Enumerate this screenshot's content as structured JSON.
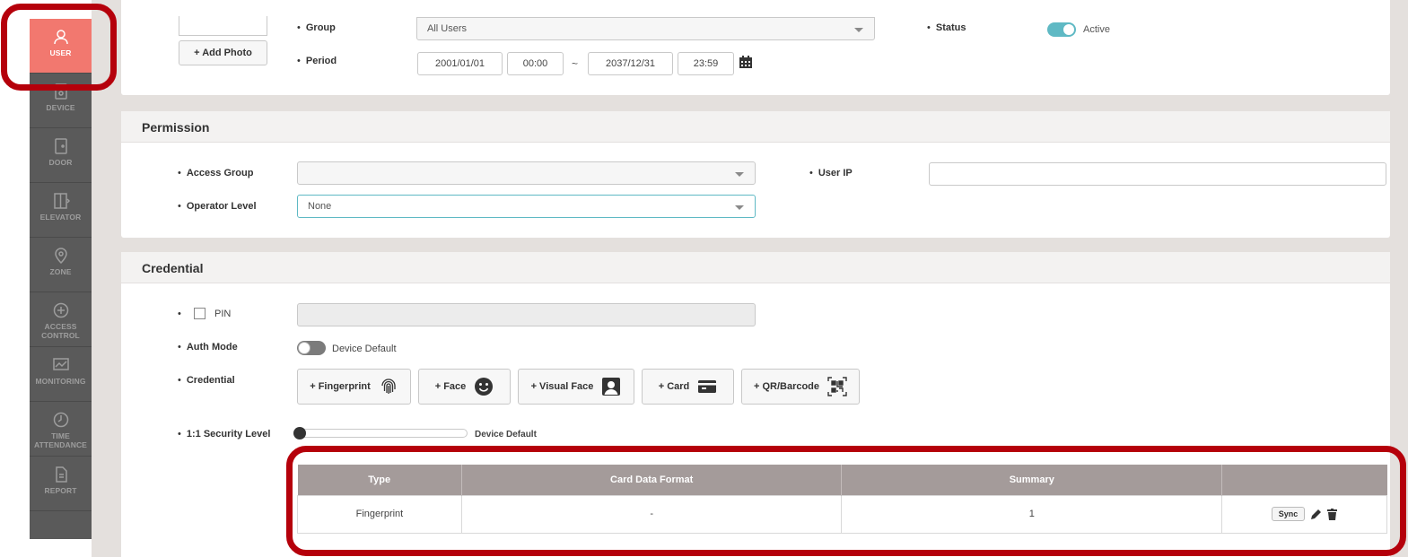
{
  "sidebar": {
    "items": [
      {
        "label": "USER",
        "icon": "user-icon",
        "active": true
      },
      {
        "label": "DEVICE",
        "icon": "device-icon"
      },
      {
        "label": "DOOR",
        "icon": "door-icon"
      },
      {
        "label": "ELEVATOR",
        "icon": "elevator-icon"
      },
      {
        "label": "ZONE",
        "icon": "zone-pin-icon"
      },
      {
        "label": "ACCESS CONTROL",
        "icon": "access-control-icon"
      },
      {
        "label": "MONITORING",
        "icon": "monitoring-icon"
      },
      {
        "label": "TIME ATTENDANCE",
        "icon": "clock-icon"
      },
      {
        "label": "REPORT",
        "icon": "report-icon"
      }
    ]
  },
  "top": {
    "add_photo": "+ Add Photo",
    "group_label": "Group",
    "group_value": "All Users",
    "period_label": "Period",
    "start_date": "2001/01/01",
    "start_time": "00:00",
    "tilde": "~",
    "end_date": "2037/12/31",
    "end_time": "23:59",
    "status_label": "Status",
    "status_value": "Active"
  },
  "permission": {
    "title": "Permission",
    "access_group_label": "Access Group",
    "access_group_value": "",
    "operator_level_label": "Operator Level",
    "operator_level_value": "None",
    "user_ip_label": "User IP",
    "user_ip_value": ""
  },
  "credential": {
    "title": "Credential",
    "pin_label": "PIN",
    "auth_mode_label": "Auth Mode",
    "auth_mode_value": "Device Default",
    "credential_label": "Credential",
    "buttons": {
      "fingerprint": "+ Fingerprint",
      "face": "+ Face",
      "visual_face": "+ Visual Face",
      "card": "+ Card",
      "qr": "+ QR/Barcode"
    },
    "security_label": "1:1 Security Level",
    "security_value": "Device Default",
    "table": {
      "headers": [
        "Type",
        "Card Data Format",
        "Summary",
        ""
      ],
      "rows": [
        {
          "type": "Fingerprint",
          "format": "-",
          "summary": "1",
          "sync": "Sync"
        }
      ]
    }
  },
  "colors": {
    "accent": "#f2786f",
    "sidebar": "#5a5a5a",
    "toggle_on": "#5fb9c4",
    "table_header": "#a49b9a",
    "annotation": "#b5000b"
  }
}
